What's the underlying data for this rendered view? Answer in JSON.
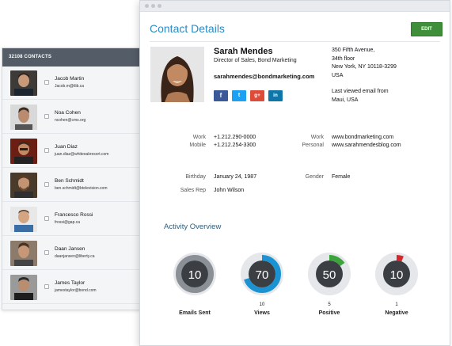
{
  "contacts": {
    "header": "32108 CONTACTS",
    "items": [
      {
        "name": "Jacob Martin",
        "email": "Jacob.m@tlib.ca"
      },
      {
        "name": "Noa Cohen",
        "email": "ncohen@cms.org"
      },
      {
        "name": "Juan Diaz",
        "email": "juan.diaz@whiteoakresort.com"
      },
      {
        "name": "Ben Schmidt",
        "email": "ben.schmidt@btelevision.com"
      },
      {
        "name": "Francesco Rossi",
        "email": "frossi@gap.ca"
      },
      {
        "name": "Daan Jansen",
        "email": "daanjansen@liberty.ca"
      },
      {
        "name": "James Taylor",
        "email": "jamestaylor@bond.com"
      }
    ]
  },
  "details": {
    "title": "Contact Details",
    "edit_label": "EDIT",
    "name": "Sarah Mendes",
    "role": "Director of Sales, Bond Marketing",
    "email": "sarahmendes@bondmarketing.com",
    "social": {
      "facebook": "f",
      "twitter": "t",
      "googleplus": "g+",
      "linkedin": "in"
    },
    "address": {
      "line1": "350 Fifth Avenue,",
      "line2": "34th floor",
      "line3": "New York, NY 10118-3299",
      "line4": "USA"
    },
    "last_viewed": {
      "line1": "Last viewed email from",
      "line2": "Maui, USA"
    },
    "phones": {
      "work_label": "Work",
      "work_value": "+1.212.290-0000",
      "mobile_label": "Mobile",
      "mobile_value": "+1.212.254-3300"
    },
    "websites": {
      "work_label": "Work",
      "work_value": "www.bondmarketing.com",
      "personal_label": "Personal",
      "personal_value": "www.sarahmendesblog.com"
    },
    "info": {
      "birthday_label": "Birthday",
      "birthday_value": "January 24, 1987",
      "gender_label": "Gender",
      "gender_value": "Female",
      "sales_rep_label": "Sales Rep",
      "sales_rep_value": "John Wilson"
    }
  },
  "activity": {
    "title": "Activity Overview",
    "gauges": [
      {
        "label": "Emails Sent",
        "value": "10",
        "count": "",
        "fraction": 1.0,
        "color": "#8a9096"
      },
      {
        "label": "Views",
        "value": "70",
        "count": "10",
        "fraction": 0.7,
        "color": "#1b93d3"
      },
      {
        "label": "Positive",
        "value": "50",
        "count": "5",
        "fraction": 0.15,
        "color": "#3aa53a"
      },
      {
        "label": "Negative",
        "value": "10",
        "count": "1",
        "fraction": 0.06,
        "color": "#d9262c"
      }
    ]
  },
  "colors": {
    "accent": "#2a8cc4",
    "edit_button": "#3f8f3a",
    "header_bar": "#545c68",
    "gauge_bg": "#3b3f44"
  }
}
